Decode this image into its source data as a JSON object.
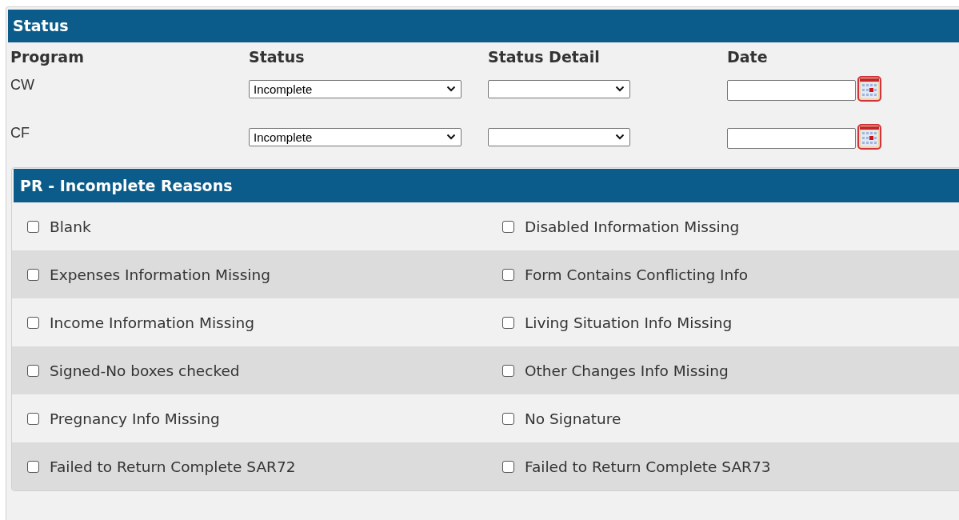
{
  "status_section": {
    "title": "Status",
    "columns": [
      "Program",
      "Status",
      "Status Detail",
      "Date"
    ],
    "rows": [
      {
        "program": "CW",
        "status": "Incomplete"
      },
      {
        "program": "CF",
        "status": "Incomplete"
      }
    ]
  },
  "reasons_section": {
    "title": "PR - Incomplete Reasons",
    "items": [
      {
        "label": "Blank",
        "checked": false
      },
      {
        "label": "Disabled Information Missing",
        "checked": false
      },
      {
        "label": "Expenses Information Missing",
        "checked": false
      },
      {
        "label": "Form Contains Conflicting Info",
        "checked": false
      },
      {
        "label": "Income Information Missing",
        "checked": false
      },
      {
        "label": "Living Situation Info Missing",
        "checked": false
      },
      {
        "label": "Signed-No boxes checked",
        "checked": false
      },
      {
        "label": "Other Changes Info Missing",
        "checked": false
      },
      {
        "label": "Pregnancy Info Missing",
        "checked": false
      },
      {
        "label": "No Signature",
        "checked": false
      },
      {
        "label": "Failed to Return Complete SAR72",
        "checked": false
      },
      {
        "label": "Failed to Return Complete SAR73",
        "checked": false
      }
    ]
  }
}
